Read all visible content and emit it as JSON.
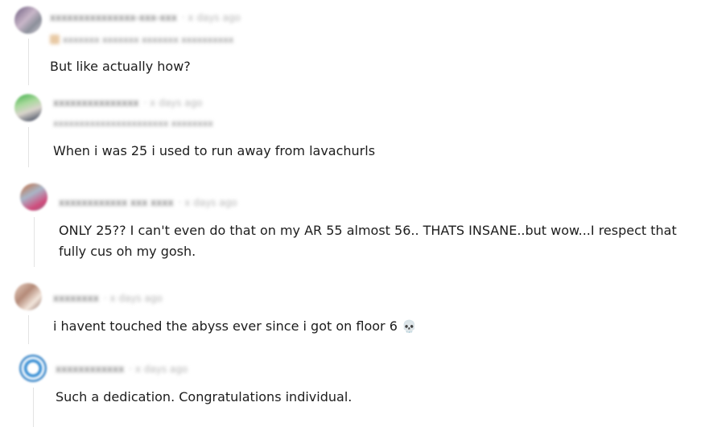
{
  "comments": [
    {
      "username": "xxxxxxxxxxxxxxx-xxx-xxx",
      "time": "· x days ago",
      "flair": "xxxxxxx xxxxxxx xxxxxxx xxxxxxxxxx",
      "text": "But like actually how?"
    },
    {
      "username": "xxxxxxxxxxxxxxx",
      "time": "· x days ago",
      "flair": "xxxxxxxxxxxxxxxxxxxxxx xxxxxxxx",
      "text": "When i was 25 i used to run away from lavachurls"
    },
    {
      "username": "xxxxxxxxxxxx xxx xxxx",
      "time": "· x days ago",
      "text": "ONLY 25?? I can't even do that on my AR 55 almost 56.. THATS INSANE..but wow...I respect that fully cus oh my gosh."
    },
    {
      "username": "xxxxxxxx",
      "time": "· x days ago",
      "text": "i havent touched the abyss ever since i got on floor 6",
      "emoji": "💀"
    },
    {
      "username": "xxxxxxxxxxxx",
      "time": "· x days ago",
      "text": "Such a dedication. Congratulations individual."
    }
  ]
}
